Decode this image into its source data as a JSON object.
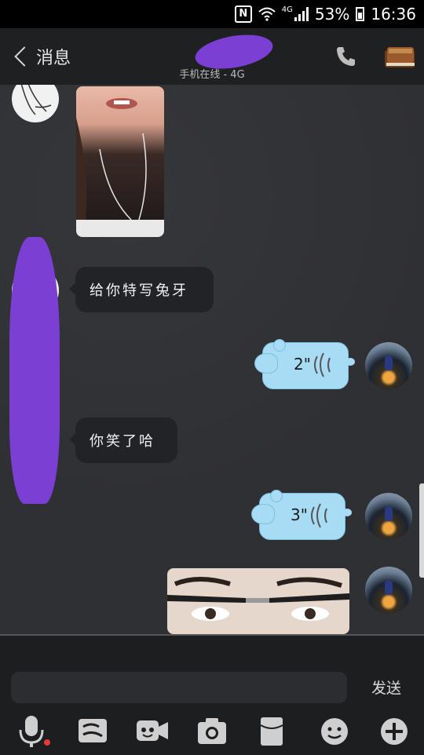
{
  "status_bar": {
    "nfc": "N",
    "network": "4G",
    "battery": "53%",
    "time": "16:36"
  },
  "header": {
    "back_label": "消息",
    "contact_name": "",
    "contact_status": "手机在线 - 4G",
    "icons": [
      "phone-icon",
      "profile-book-icon"
    ]
  },
  "messages": [
    {
      "side": "left",
      "type": "photo",
      "icon": "photo-image"
    },
    {
      "side": "left",
      "type": "text",
      "text": "给你特写兔牙"
    },
    {
      "side": "right",
      "type": "voice",
      "duration": "2\""
    },
    {
      "side": "left",
      "type": "text",
      "text": "你笑了哈"
    },
    {
      "side": "right",
      "type": "voice",
      "duration": "3\""
    },
    {
      "side": "right",
      "type": "photo",
      "icon": "photo-image"
    }
  ],
  "input": {
    "placeholder": "",
    "send_label": "发送"
  },
  "toolbar": [
    "microphone-icon",
    "doodle-icon",
    "video-icon",
    "camera-icon",
    "red-packet-icon",
    "emoji-icon",
    "plus-icon"
  ],
  "colors": {
    "voice_bubble": "#a8dcf5",
    "text_bubble": "#222326",
    "chat_background": "#2f3034",
    "redaction": "#7b3fd4"
  }
}
